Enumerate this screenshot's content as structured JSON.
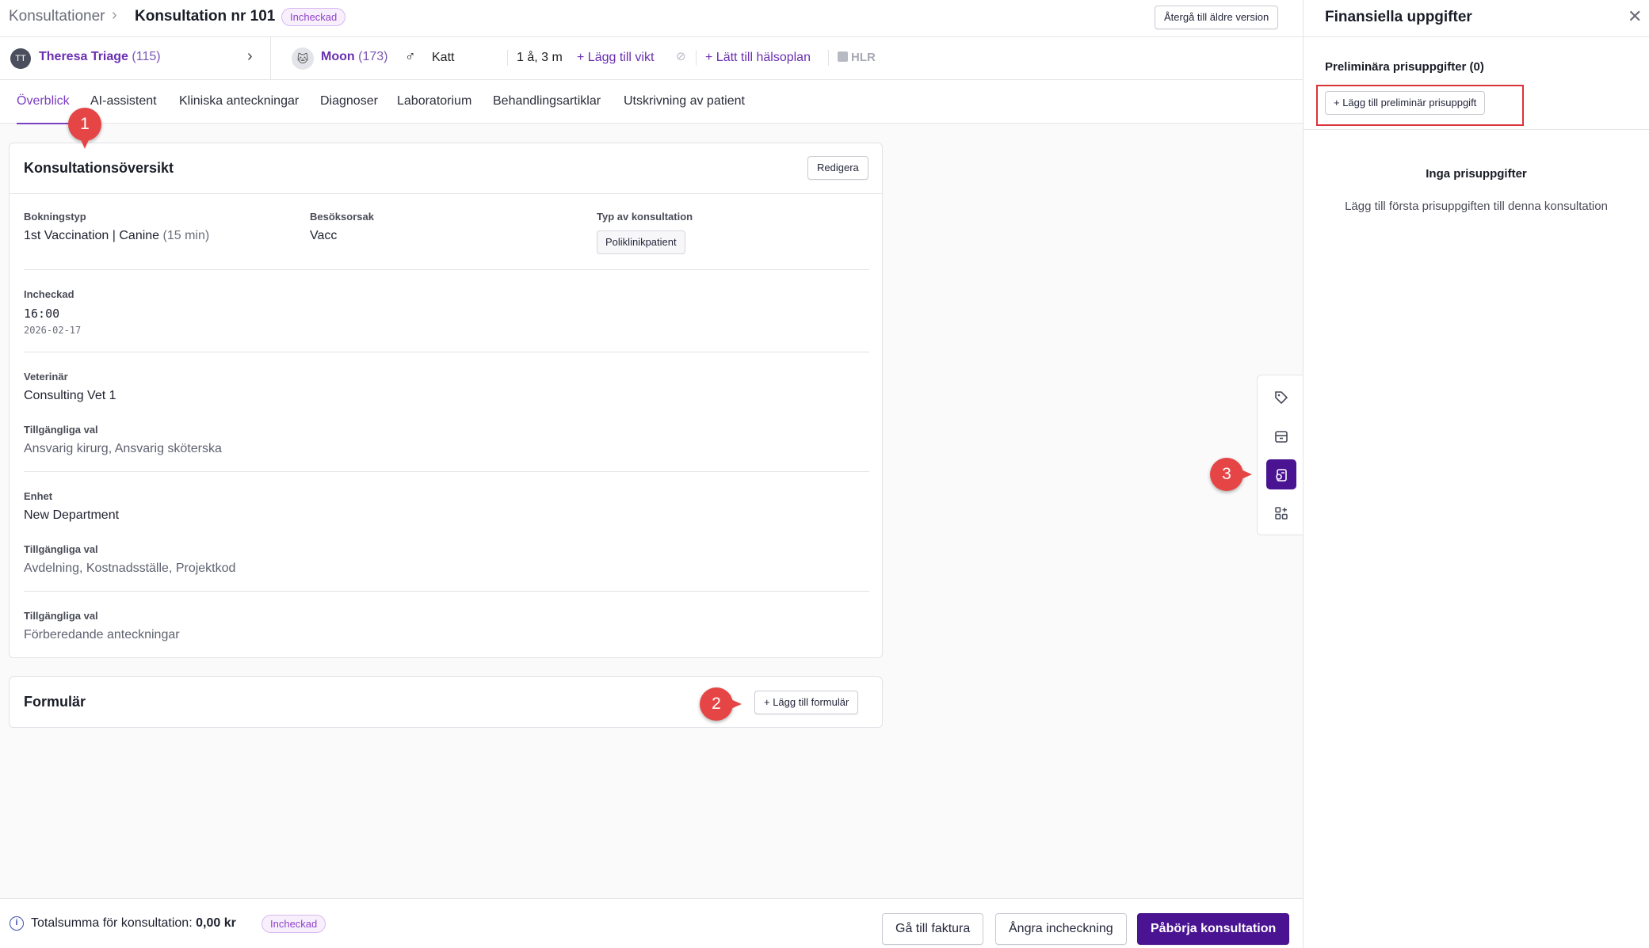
{
  "header": {
    "breadcrumb_root": "Konsultationer",
    "breadcrumb_sep": "›",
    "title": "Konsultation nr 101",
    "status_badge": "Incheckad",
    "older_version_button": "Återgå till äldre version"
  },
  "patient_bar": {
    "owner_initials": "TT",
    "owner_name": "Theresa Triage",
    "owner_id": "(115)",
    "pet_name": "Moon",
    "pet_id": "(173)",
    "pet_sex_symbol": "♂",
    "species": "Katt",
    "age": "1 å, 3 m",
    "add_weight": "+ Lägg till vikt",
    "add_healthplan": "+ Lätt till hälsoplan",
    "hlr": "HLR"
  },
  "tabs": [
    {
      "label": "Överblick",
      "active": true
    },
    {
      "label": "AI-assistent"
    },
    {
      "label": "Kliniska anteckningar"
    },
    {
      "label": "Diagnoser"
    },
    {
      "label": "Laboratorium"
    },
    {
      "label": "Behandlingsartiklar"
    },
    {
      "label": "Utskrivning av patient"
    }
  ],
  "overview": {
    "title": "Konsultationsöversikt",
    "edit_button": "Redigera",
    "booking_type_label": "Bokningstyp",
    "booking_type_value": "1st Vaccination | Canine",
    "booking_type_duration": "(15 min)",
    "visit_reason_label": "Besöksorsak",
    "visit_reason_value": "Vacc",
    "consult_type_label": "Typ av konsultation",
    "consult_type_value": "Poliklinikpatient",
    "checked_in_label": "Incheckad",
    "checked_in_time": "16:00",
    "checked_in_date": "2026-02-17",
    "vet_label": "Veterinär",
    "vet_value": "Consulting Vet 1",
    "vet_options_label": "Tillgängliga val",
    "vet_options_value": "Ansvarig kirurg, Ansvarig sköterska",
    "unit_label": "Enhet",
    "unit_value": "New Department",
    "unit_options_label": "Tillgängliga val",
    "unit_options_value": "Avdelning, Kostnadsställe, Projektkod",
    "notes_options_label": "Tillgängliga val",
    "notes_options_value": "Förberedande anteckningar"
  },
  "forms": {
    "title": "Formulär",
    "add_button": "+ Lägg till formulär"
  },
  "toolstrip": {
    "tools": [
      "tag-icon",
      "calendar-box-icon",
      "finance-icon",
      "widgets-icon"
    ],
    "active_index": 2,
    "accent_color": "#4a1391"
  },
  "bottom_bar": {
    "info_icon": "i",
    "total_label": "Totalsumma för konsultation:",
    "total_amount": "0,00 kr",
    "status_badge": "Incheckad",
    "invoice_button": "Gå till faktura",
    "undo_checkin_button": "Ångra incheckning",
    "start_button": "Påbörja konsultation"
  },
  "financial_panel": {
    "title": "Finansiella uppgifter",
    "close": "✕",
    "prelim_title": "Preliminära prisuppgifter (0)",
    "prelim_add_button": "+ Lägg till preliminär prisuppgift",
    "empty_title": "Inga prisuppgifter",
    "empty_text": "Lägg till första prisuppgiften till denna konsultation"
  },
  "callouts": [
    "1",
    "2",
    "3"
  ],
  "colors": {
    "accent": "#4a1391",
    "link": "#6a2fb1",
    "callout": "#e54545",
    "highlight": "#d9333a"
  }
}
